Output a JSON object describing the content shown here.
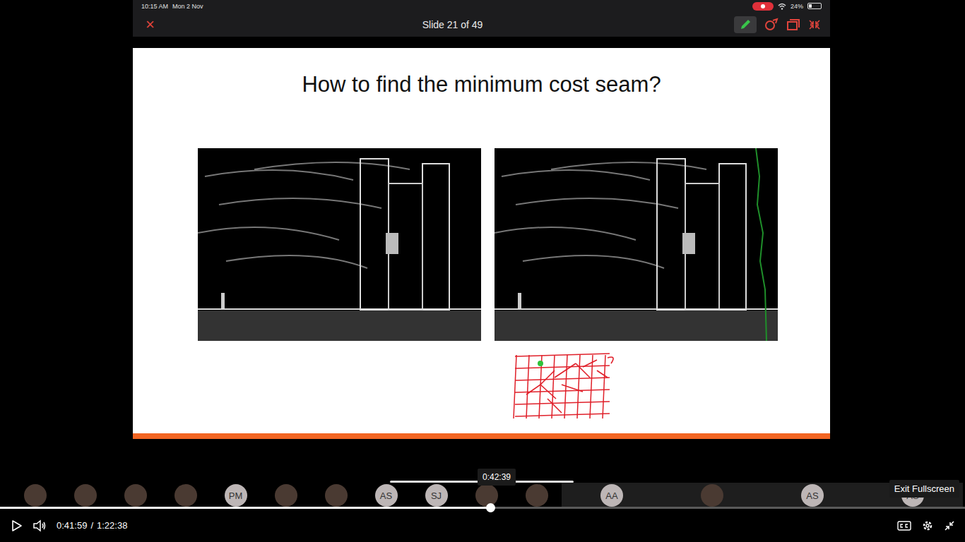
{
  "status_bar": {
    "time": "10:15 AM",
    "date": "Mon 2 Nov",
    "battery": "24%",
    "battery_level": 0.24,
    "recording": true
  },
  "slide_bar": {
    "close": "×",
    "counter": "Slide 21 of 49",
    "pen_active": true
  },
  "slide": {
    "title": "How to find the minimum cost seam?"
  },
  "participants": [
    {
      "kind": "photo"
    },
    {
      "kind": "photo"
    },
    {
      "kind": "photo"
    },
    {
      "kind": "photo"
    },
    {
      "kind": "initials",
      "initials": "PM"
    },
    {
      "kind": "photo"
    },
    {
      "kind": "photo"
    },
    {
      "kind": "initials",
      "initials": "AS"
    },
    {
      "kind": "initials",
      "initials": "SJ"
    },
    {
      "kind": "photo"
    },
    {
      "kind": "photo"
    },
    {
      "kind": "initials",
      "initials": "AA"
    },
    {
      "kind": "photo"
    },
    {
      "kind": "initials",
      "initials": "AS"
    },
    {
      "kind": "initials",
      "initials": "AS"
    }
  ],
  "player": {
    "playing": false,
    "progress": 0.508,
    "current_time": "0:41:59",
    "separator": "/",
    "duration": "1:22:38",
    "hover_time": "0:42:39",
    "tooltip": "Exit Fullscreen"
  }
}
